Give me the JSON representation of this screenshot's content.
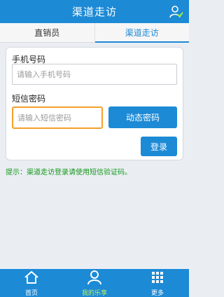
{
  "header": {
    "title": "渠道走访"
  },
  "tabs": [
    {
      "label": "直销员",
      "active": false
    },
    {
      "label": "渠道走访",
      "active": true
    }
  ],
  "form": {
    "phone_label": "手机号码",
    "phone_placeholder": "请输入手机号码",
    "phone_value": "",
    "sms_label": "短信密码",
    "sms_placeholder": "请输入短信密码",
    "sms_value": "",
    "dynamic_button": "动态密码",
    "login_button": "登录"
  },
  "hint": "提示：渠道走访登录请使用短信验证码。",
  "footer": {
    "items": [
      {
        "label": "首页",
        "icon": "home-icon",
        "active": false
      },
      {
        "label": "我的乐享",
        "icon": "user-icon",
        "active": true
      },
      {
        "label": "更多",
        "icon": "grid-icon",
        "active": false
      }
    ]
  },
  "colors": {
    "primary": "#1d8ad6",
    "active_footer": "#b8f35a",
    "hint": "#15981c",
    "focus_border": "#f3a02a"
  }
}
